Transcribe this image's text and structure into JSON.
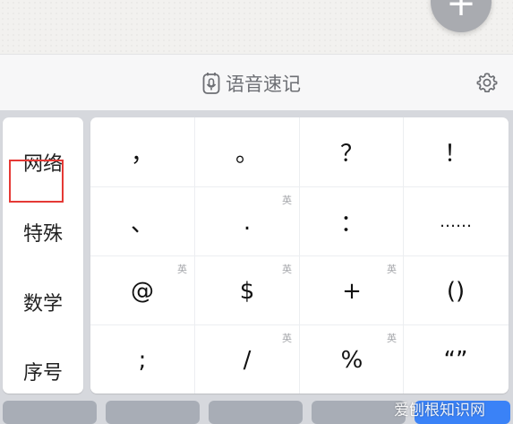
{
  "toolbar": {
    "voice_label": "语音速记"
  },
  "sidebar": {
    "items": [
      {
        "label": "网络"
      },
      {
        "label": "特殊"
      },
      {
        "label": "数学"
      },
      {
        "label": "序号"
      }
    ],
    "highlighted": "数学"
  },
  "keys": [
    {
      "symbol": "，",
      "badge": ""
    },
    {
      "symbol": "。",
      "badge": ""
    },
    {
      "symbol": "？",
      "badge": ""
    },
    {
      "symbol": "！",
      "badge": ""
    },
    {
      "symbol": "、",
      "badge": ""
    },
    {
      "symbol": ".",
      "badge": "英"
    },
    {
      "symbol": "：",
      "badge": ""
    },
    {
      "symbol": "……",
      "badge": ""
    },
    {
      "symbol": "@",
      "badge": "英"
    },
    {
      "symbol": "$",
      "badge": "英"
    },
    {
      "symbol": "+",
      "badge": "英"
    },
    {
      "symbol": "()",
      "badge": ""
    },
    {
      "symbol": ";",
      "badge": ""
    },
    {
      "symbol": "/",
      "badge": "英"
    },
    {
      "symbol": "%",
      "badge": "英"
    },
    {
      "symbol": "“”",
      "badge": ""
    }
  ],
  "watermark": "爱刨根知识网",
  "colors": {
    "highlight_border": "#e53935",
    "accent_blue": "#3a82f7"
  }
}
